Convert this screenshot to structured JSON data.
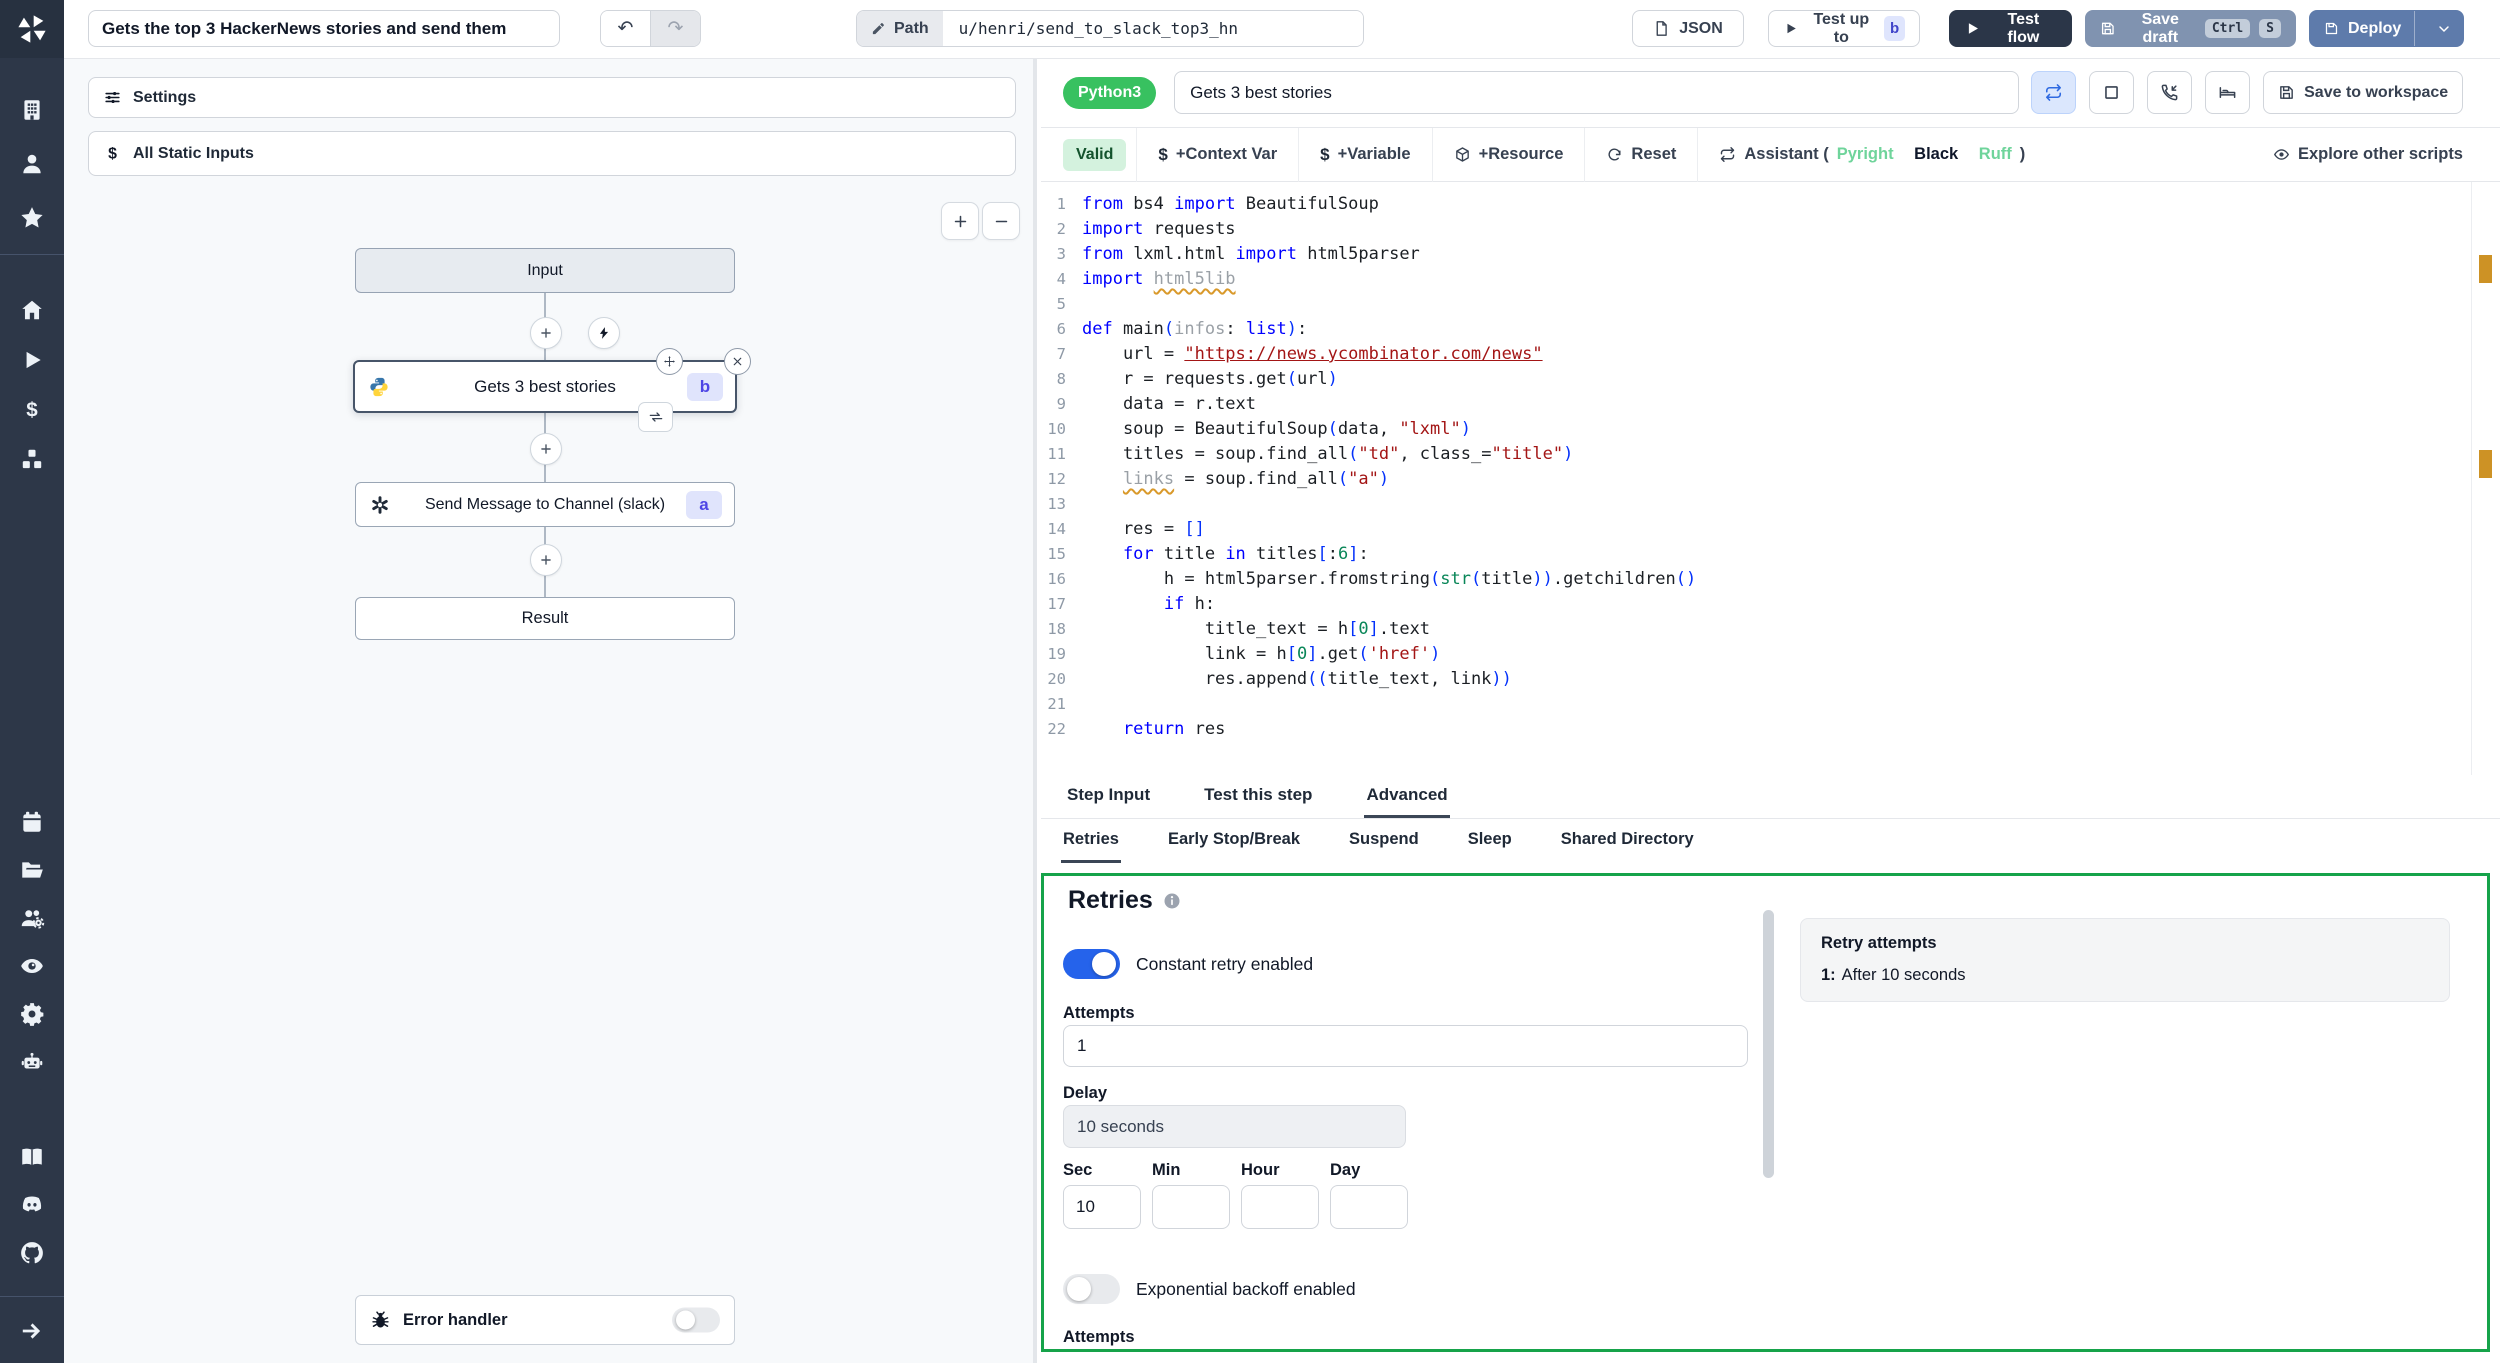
{
  "topbar": {
    "flow_title": "Gets the top 3 HackerNews stories and send them",
    "path_label": "Path",
    "path_value": "u/henri/send_to_slack_top3_hn",
    "json_label": "JSON",
    "test_up_to_label": "Test up to",
    "test_up_to_badge": "b",
    "test_flow_label": "Test flow",
    "save_draft_label": "Save draft",
    "save_draft_kbd": [
      "Ctrl",
      "S"
    ],
    "deploy_label": "Deploy"
  },
  "sidebar": {
    "top_icons": [
      "building",
      "user",
      "star"
    ],
    "nav_icons": [
      "home",
      "play",
      "dollar",
      "cubes"
    ],
    "mid_icons": [
      "calendar",
      "folder",
      "users-gear",
      "eye",
      "gear",
      "robot"
    ],
    "link_icons": [
      "book",
      "discord",
      "github"
    ],
    "bottom_icons": [
      "arrow-right"
    ]
  },
  "flow_panel": {
    "settings_label": "Settings",
    "static_inputs_label": "All Static Inputs",
    "nodes": {
      "input": {
        "label": "Input"
      },
      "step_b": {
        "label": "Gets 3 best stories",
        "badge": "b"
      },
      "step_a": {
        "label": "Send Message to Channel (slack)",
        "badge": "a"
      },
      "result": {
        "label": "Result"
      }
    },
    "error_handler_label": "Error handler"
  },
  "editor": {
    "language_badge": "Python3",
    "step_title": "Gets 3 best stories",
    "save_to_workspace_label": "Save to workspace",
    "toolbar": {
      "valid_label": "Valid",
      "context_var_label": "+Context Var",
      "variable_label": "+Variable",
      "resource_label": "+Resource",
      "reset_label": "Reset",
      "assistant_prefix": "Assistant (",
      "assistant_linters": [
        "Pyright",
        "Black",
        "Ruff"
      ],
      "assistant_suffix": ")",
      "explore_label": "Explore other scripts"
    },
    "tabs": [
      {
        "label": "Step Input",
        "active": false
      },
      {
        "label": "Test this step",
        "active": false
      },
      {
        "label": "Advanced",
        "active": true
      }
    ],
    "subtabs": [
      {
        "label": "Retries",
        "active": true
      },
      {
        "label": "Early Stop/Break",
        "active": false
      },
      {
        "label": "Suspend",
        "active": false
      },
      {
        "label": "Sleep",
        "active": false
      },
      {
        "label": "Shared Directory",
        "active": false
      }
    ],
    "code": {
      "lines": [
        [
          {
            "c": "k",
            "t": "from "
          },
          {
            "c": "d",
            "t": "bs4 "
          },
          {
            "c": "k",
            "t": "import "
          },
          {
            "c": "d",
            "t": "BeautifulSoup"
          }
        ],
        [
          {
            "c": "k",
            "t": "import "
          },
          {
            "c": "d",
            "t": "requests"
          }
        ],
        [
          {
            "c": "k",
            "t": "from "
          },
          {
            "c": "d",
            "t": "lxml.html "
          },
          {
            "c": "k",
            "t": "import "
          },
          {
            "c": "d",
            "t": "html5parser"
          }
        ],
        [
          {
            "c": "k",
            "t": "import "
          },
          {
            "c": "w",
            "t": "html5lib"
          }
        ],
        [],
        [
          {
            "c": "k",
            "t": "def "
          },
          {
            "c": "d",
            "t": "main"
          },
          {
            "c": "p",
            "t": "("
          },
          {
            "c": "f",
            "t": "infos"
          },
          {
            "c": "d",
            "t": ": "
          },
          {
            "c": "k",
            "t": "list"
          },
          {
            "c": "p",
            "t": ")"
          },
          {
            "c": "d",
            "t": ":"
          }
        ],
        [
          {
            "c": "d",
            "t": "    url = "
          },
          {
            "c": "u",
            "t": "\"https://news.ycombinator.com/news\""
          }
        ],
        [
          {
            "c": "d",
            "t": "    r = requests.get"
          },
          {
            "c": "p",
            "t": "("
          },
          {
            "c": "d",
            "t": "url"
          },
          {
            "c": "p",
            "t": ")"
          }
        ],
        [
          {
            "c": "d",
            "t": "    data = r.text"
          }
        ],
        [
          {
            "c": "d",
            "t": "    soup = BeautifulSoup"
          },
          {
            "c": "p",
            "t": "("
          },
          {
            "c": "d",
            "t": "data, "
          },
          {
            "c": "s",
            "t": "\"lxml\""
          },
          {
            "c": "p",
            "t": ")"
          }
        ],
        [
          {
            "c": "d",
            "t": "    titles = soup.find_all"
          },
          {
            "c": "p",
            "t": "("
          },
          {
            "c": "s",
            "t": "\"td\""
          },
          {
            "c": "d",
            "t": ", class_="
          },
          {
            "c": "s",
            "t": "\"title\""
          },
          {
            "c": "p",
            "t": ")"
          }
        ],
        [
          {
            "c": "d",
            "t": "    "
          },
          {
            "c": "w",
            "t": "links"
          },
          {
            "c": "d",
            "t": " = soup.find_all"
          },
          {
            "c": "p",
            "t": "("
          },
          {
            "c": "s",
            "t": "\"a\""
          },
          {
            "c": "p",
            "t": ")"
          }
        ],
        [],
        [
          {
            "c": "d",
            "t": "    res = "
          },
          {
            "c": "p",
            "t": "[]"
          }
        ],
        [
          {
            "c": "k",
            "t": "    for"
          },
          {
            "c": "d",
            "t": " title "
          },
          {
            "c": "k",
            "t": "in"
          },
          {
            "c": "d",
            "t": " titles"
          },
          {
            "c": "p",
            "t": "["
          },
          {
            "c": "d",
            "t": ":"
          },
          {
            "c": "n",
            "t": "6"
          },
          {
            "c": "p",
            "t": "]"
          },
          {
            "c": "d",
            "t": ":"
          }
        ],
        [
          {
            "c": "d",
            "t": "        h = html5parser.fromstring"
          },
          {
            "c": "p",
            "t": "("
          },
          {
            "c": "n",
            "t": "str"
          },
          {
            "c": "p",
            "t": "("
          },
          {
            "c": "d",
            "t": "title"
          },
          {
            "c": "p",
            "t": "))"
          },
          {
            "c": "d",
            "t": ".getchildren"
          },
          {
            "c": "p",
            "t": "()"
          }
        ],
        [
          {
            "c": "k",
            "t": "        if"
          },
          {
            "c": "d",
            "t": " h:"
          }
        ],
        [
          {
            "c": "d",
            "t": "            title_text = h"
          },
          {
            "c": "p",
            "t": "["
          },
          {
            "c": "n",
            "t": "0"
          },
          {
            "c": "p",
            "t": "]"
          },
          {
            "c": "d",
            "t": ".text"
          }
        ],
        [
          {
            "c": "d",
            "t": "            link = h"
          },
          {
            "c": "p",
            "t": "["
          },
          {
            "c": "n",
            "t": "0"
          },
          {
            "c": "p",
            "t": "]"
          },
          {
            "c": "d",
            "t": ".get"
          },
          {
            "c": "p",
            "t": "("
          },
          {
            "c": "s",
            "t": "'href'"
          },
          {
            "c": "p",
            "t": ")"
          }
        ],
        [
          {
            "c": "d",
            "t": "            res.append"
          },
          {
            "c": "p",
            "t": "(("
          },
          {
            "c": "d",
            "t": "title_text, link"
          },
          {
            "c": "p",
            "t": "))"
          }
        ],
        [],
        [
          {
            "c": "k",
            "t": "    return"
          },
          {
            "c": "d",
            "t": " res"
          }
        ]
      ]
    }
  },
  "retries_panel": {
    "title": "Retries",
    "constant_retry_label": "Constant retry enabled",
    "constant_retry_enabled": true,
    "attempts_label": "Attempts",
    "attempts_value": "1",
    "delay_label": "Delay",
    "delay_value": "10 seconds",
    "time_fields": [
      {
        "label": "Sec",
        "value": "10"
      },
      {
        "label": "Min",
        "value": ""
      },
      {
        "label": "Hour",
        "value": ""
      },
      {
        "label": "Day",
        "value": ""
      }
    ],
    "exponential_backoff_label": "Exponential backoff enabled",
    "exponential_backoff_enabled": false,
    "next_section_label": "Attempts",
    "summary": {
      "title": "Retry attempts",
      "entries": [
        {
          "index": "1:",
          "text": "After 10 seconds"
        }
      ]
    }
  },
  "colors": {
    "accent_green": "#16a34a",
    "toggle_on_blue": "#2563eb",
    "badge_indigo": "#4f46e5",
    "warning_amber": "#c8860d",
    "sidebar_dark": "#2d3748"
  }
}
